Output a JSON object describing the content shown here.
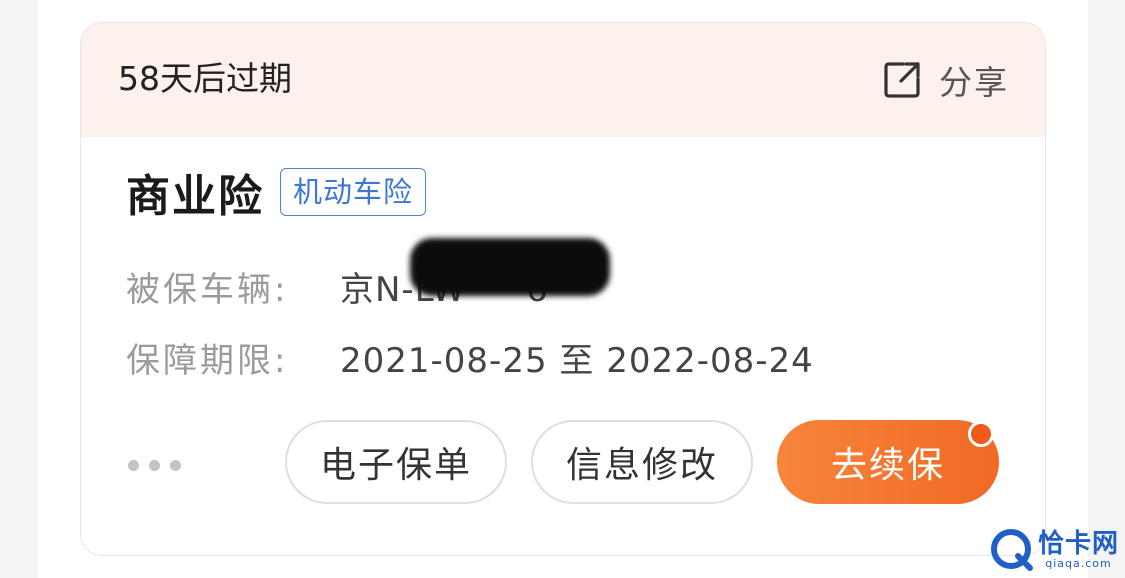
{
  "header": {
    "expiry_text": "58天后过期",
    "share_label": "分享",
    "share_icon": "share-external-icon"
  },
  "policy": {
    "title": "商业险",
    "tag": "机动车险",
    "vehicle_label": "被保车辆:",
    "vehicle_value": "京N-LW",
    "vehicle_value_tail": "6",
    "period_label": "保障期限:",
    "period_value": "2021-08-25 至 2022-08-24"
  },
  "actions": {
    "more_icon": "more-dots-icon",
    "e_policy": "电子保单",
    "edit_info": "信息修改",
    "renew": "去续保"
  },
  "watermark": {
    "name": "恰卡网",
    "url": "qiaqa.com"
  },
  "colors": {
    "header_bg": "#fcf1ec",
    "tag_blue": "#3b78d8",
    "renew_orange": "#f06a24"
  }
}
